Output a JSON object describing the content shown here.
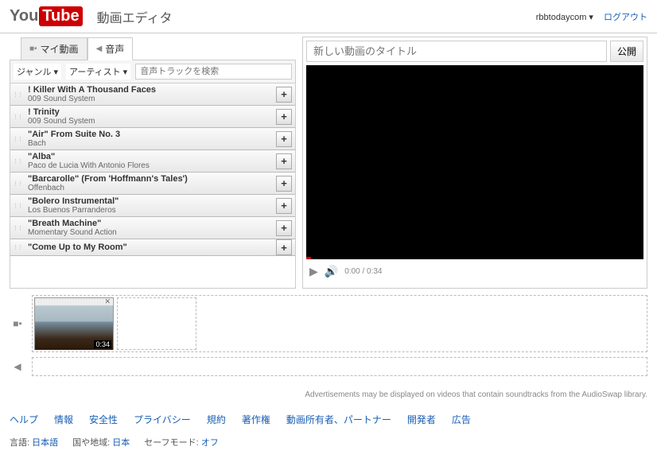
{
  "header": {
    "logo_you": "You",
    "logo_tube": "Tube",
    "title": "動画エディタ",
    "username": "rbbtodaycom",
    "logout": "ログアウト"
  },
  "tabs": {
    "my_videos": "マイ動画",
    "audio": "音声"
  },
  "filters": {
    "genre": "ジャンル",
    "artist": "アーティスト",
    "search_placeholder": "音声トラックを検索"
  },
  "tracks": [
    {
      "title": "! Killer With A Thousand Faces",
      "artist": "009 Sound System"
    },
    {
      "title": "! Trinity",
      "artist": "009 Sound System"
    },
    {
      "title": "\"Air\" From Suite No. 3",
      "artist": "Bach"
    },
    {
      "title": "\"Alba\"",
      "artist": "Paco de Lucia With Antonio Flores"
    },
    {
      "title": "\"Barcarolle\" (From 'Hoffmann's Tales')",
      "artist": "Offenbach"
    },
    {
      "title": "\"Bolero Instrumental\"",
      "artist": "Los Buenos Parranderos"
    },
    {
      "title": "\"Breath Machine\"",
      "artist": "Momentary Sound Action"
    },
    {
      "title": "\"Come Up to My Room\"",
      "artist": ""
    }
  ],
  "editor": {
    "title_placeholder": "新しい動画のタイトル",
    "publish": "公開",
    "time": "0:00 / 0:34"
  },
  "clip": {
    "duration": "0:34"
  },
  "disclosure": "Advertisements may be displayed on videos that contain soundtracks from the AudioSwap library.",
  "footer": {
    "links": [
      "ヘルプ",
      "情報",
      "安全性",
      "プライバシー",
      "規約",
      "著作権",
      "動画所有者、パートナー",
      "開発者",
      "広告"
    ],
    "lang_label": "言語:",
    "lang_value": "日本語",
    "region_label": "国や地域:",
    "region_value": "日本",
    "safe_label": "セーフモード:",
    "safe_value": "オフ"
  }
}
